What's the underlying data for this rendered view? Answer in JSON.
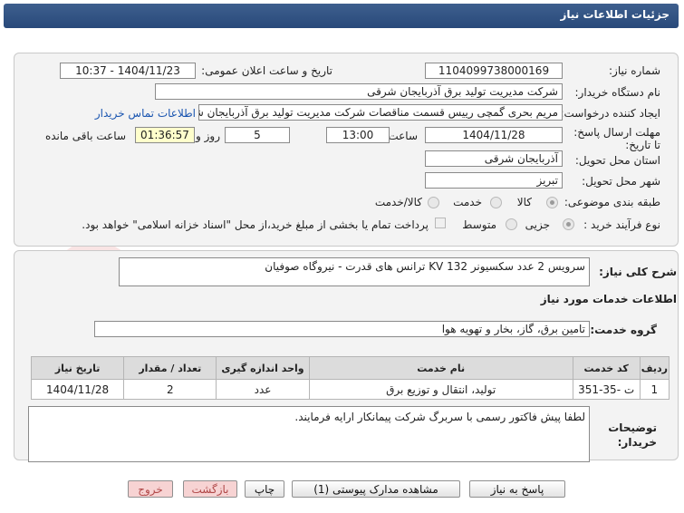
{
  "title": "جزئیات اطلاعات نیاز",
  "fields": {
    "need_number_label": "شماره نیاز:",
    "need_number": "1104099738000169",
    "announce_label": "تاریخ و ساعت اعلان عمومی:",
    "announce_value": "1404/11/23 - 10:37",
    "buyer_org_label": "نام دستگاه خریدار:",
    "buyer_org": "شرکت مدیریت تولید برق آذربایجان شرقی",
    "creator_label": "ایجاد کننده درخواست:",
    "creator": "مریم بحری گمچی رییس قسمت مناقصات شرکت مدیریت تولید برق آذربایجان شر",
    "contact_link": "اطلاعات تماس خریدار",
    "deadline_label": "مهلت ارسال پاسخ: تا تاریخ:",
    "deadline_date": "1404/11/28",
    "time_label": "ساعت",
    "deadline_time": "13:00",
    "days_value": "5",
    "days_label": "روز و",
    "remaining_time": "01:36:57",
    "remaining_label": "ساعت باقی مانده",
    "province_label": "استان محل تحویل:",
    "province": "آذربایجان شرقی",
    "city_label": "شهر محل تحویل:",
    "city": "تبریز",
    "category_label": "طبقه بندی موضوعی:",
    "category_options": [
      "کالا",
      "خدمت",
      "کالا/خدمت"
    ],
    "process_label": "نوع فرآیند خرید :",
    "process_options": [
      "جزیی",
      "متوسط"
    ],
    "payment_note": "پرداخت تمام یا بخشی از مبلغ خرید،از محل \"اسناد خزانه اسلامی\" خواهد بود."
  },
  "summary": {
    "label": "شرح کلی نیاز:",
    "value": "سرویس 2 عدد سکسیونر 132 KV ترانس های قدرت - نیروگاه صوفیان"
  },
  "services": {
    "heading": "اطلاعات خدمات مورد نیاز",
    "group_label": "گروه خدمت:",
    "group_value": "تامین برق، گاز، بخار و تهویه هوا"
  },
  "table": {
    "headers": [
      "ردیف",
      "کد خدمت",
      "نام خدمت",
      "واحد اندازه گیری",
      "تعداد / مقدار",
      "تاریخ نیاز"
    ],
    "rows": [
      [
        "1",
        "ت -35-351",
        "تولید، انتقال و توزیع برق",
        "عدد",
        "2",
        "1404/11/28"
      ]
    ]
  },
  "buyer_notes": {
    "label": "توضیحات خریدار:",
    "value": "لطفا پیش فاکتور رسمی با سربرگ شرکت پیمانکار ارایه فرمایند."
  },
  "buttons": {
    "respond": "پاسخ به نیاز",
    "attachments": "مشاهده مدارک پیوستی (1)",
    "print": "چاپ",
    "back": "بازگشت",
    "exit": "خروج"
  },
  "colors": {
    "title_bar": "#28497a",
    "link": "#1a55b0",
    "remaining_bg": "#ffffcc",
    "exit_button": "#f7d3d3"
  }
}
